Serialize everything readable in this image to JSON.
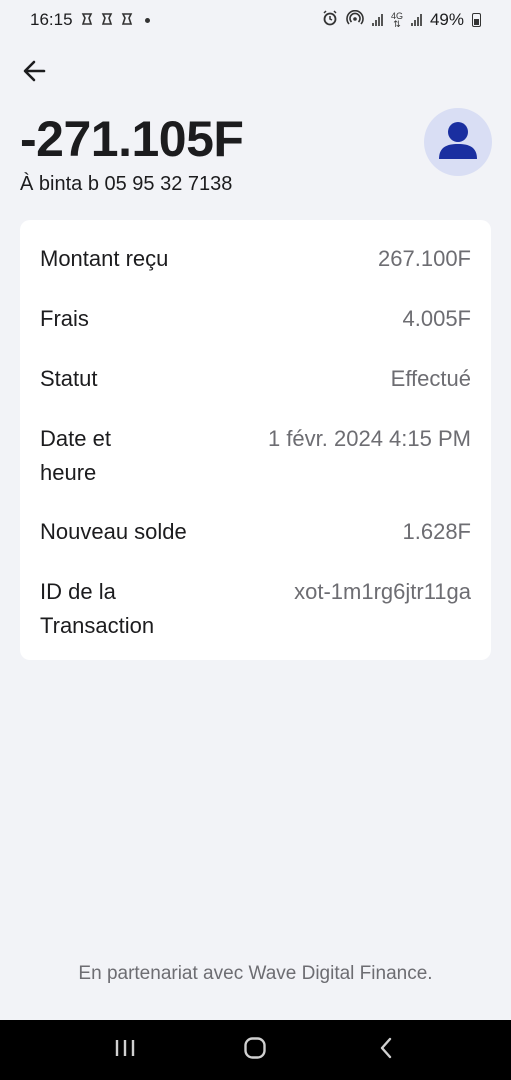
{
  "status_bar": {
    "time": "16:15",
    "notification_icons": [
      "notif-icon",
      "notif-icon",
      "notif-icon"
    ],
    "network_label_top": "4G",
    "network_label_bottom": "⇅",
    "battery_percent": "49%"
  },
  "header": {
    "amount": "-271.105F",
    "recipient": "À binta b 05 95 32 7138"
  },
  "details": [
    {
      "label": "Montant reçu",
      "value": "267.100F"
    },
    {
      "label": "Frais",
      "value": "4.005F"
    },
    {
      "label": "Statut",
      "value": "Effectué"
    },
    {
      "label": "Date et heure",
      "value": "1 févr. 2024 4:15 PM"
    },
    {
      "label": "Nouveau solde",
      "value": "1.628F"
    },
    {
      "label": "ID de la Transaction",
      "value": "xot-1m1rg6jtr11ga"
    }
  ],
  "footer": {
    "partner_text": "En partenariat avec Wave Digital Finance."
  },
  "colors": {
    "background": "#f2f3f7",
    "card": "#ffffff",
    "avatar_bg": "#d9def4",
    "avatar_fg": "#1a2fa0"
  }
}
